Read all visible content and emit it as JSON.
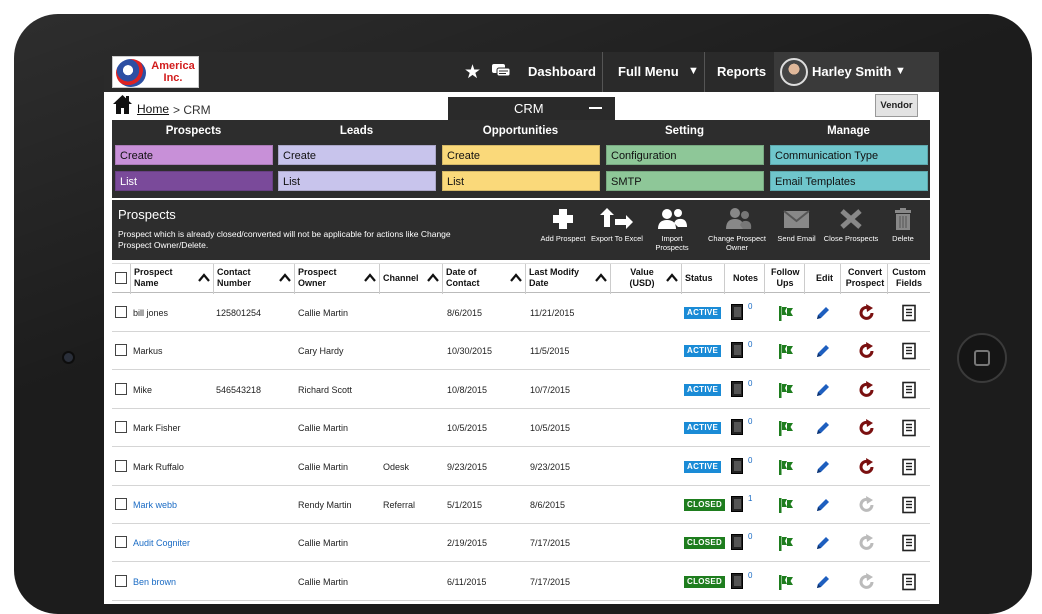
{
  "logo": {
    "text_line1": "America",
    "text_line2": "Inc."
  },
  "topnav": {
    "dashboard": "Dashboard",
    "full_menu": "Full Menu",
    "reports": "Reports",
    "user_name": "Harley Smith",
    "caret": "▼"
  },
  "breadcrumb": {
    "home": "Home",
    "current": "> CRM"
  },
  "crm_tab": "CRM",
  "vendor_button": "Vendor",
  "menu": [
    {
      "heading": "Prospects",
      "items": [
        "Create",
        "List"
      ],
      "colors": [
        "#c890d8",
        "#7a4a9a"
      ],
      "text_colors": [
        "#111111",
        "#ffffff"
      ]
    },
    {
      "heading": "Leads",
      "items": [
        "Create",
        "List"
      ],
      "colors": [
        "#c8c4ec",
        "#c8c4ec"
      ],
      "text_colors": [
        "#111111",
        "#111111"
      ]
    },
    {
      "heading": "Opportunities",
      "items": [
        "Create",
        "List"
      ],
      "colors": [
        "#fad97a",
        "#fad97a"
      ],
      "text_colors": [
        "#111111",
        "#111111"
      ]
    },
    {
      "heading": "Setting",
      "items": [
        "Configuration",
        "SMTP"
      ],
      "colors": [
        "#8ec798",
        "#8ec798"
      ],
      "text_colors": [
        "#111111",
        "#111111"
      ]
    },
    {
      "heading": "Manage",
      "items": [
        "Communication Type",
        "Email Templates"
      ],
      "colors": [
        "#6fc6cc",
        "#6fc6cc"
      ],
      "text_colors": [
        "#111111",
        "#111111"
      ]
    }
  ],
  "prospects_panel": {
    "title": "Prospects",
    "note": "Prospect which is already closed/converted will not be applicable for actions like Change Prospect Owner/Delete.",
    "actions": [
      {
        "label": "Add Prospect",
        "icon": "plus-icon"
      },
      {
        "label": "Export To Excel",
        "icon": "export-icon"
      },
      {
        "label": "Import Prospects",
        "icon": "import-users-icon"
      },
      {
        "label": "Change Prospect Owner",
        "icon": "change-owner-icon"
      },
      {
        "label": "Send Email",
        "icon": "mail-icon"
      },
      {
        "label": "Close Prospects",
        "icon": "close-x-icon"
      },
      {
        "label": "Delete",
        "icon": "trash-icon"
      }
    ]
  },
  "table": {
    "headers": {
      "name": "Prospect Name",
      "contact": "Contact Number",
      "owner": "Prospect Owner",
      "channel": "Channel",
      "date_contact": "Date of Contact",
      "last_modify": "Last Modify Date",
      "value": "Value (USD)",
      "status": "Status",
      "notes": "Notes",
      "followups": "Follow Ups",
      "edit": "Edit",
      "convert": "Convert Prospect",
      "custom": "Custom Fields"
    },
    "rows": [
      {
        "name": "bill jones",
        "contact": "125801254",
        "owner": "Callie Martin",
        "channel": "",
        "date_contact": "8/6/2015",
        "last_modify": "11/21/2015",
        "status": "ACTIVE",
        "notes": "0",
        "link": false
      },
      {
        "name": "Markus",
        "contact": "",
        "owner": "Cary Hardy",
        "channel": "",
        "date_contact": "10/30/2015",
        "last_modify": "11/5/2015",
        "status": "ACTIVE",
        "notes": "0",
        "link": false
      },
      {
        "name": "Mike",
        "contact": "546543218",
        "owner": "Richard Scott",
        "channel": "",
        "date_contact": "10/8/2015",
        "last_modify": "10/7/2015",
        "status": "ACTIVE",
        "notes": "0",
        "link": false
      },
      {
        "name": "Mark Fisher",
        "contact": "",
        "owner": "Callie Martin",
        "channel": "",
        "date_contact": "10/5/2015",
        "last_modify": "10/5/2015",
        "status": "ACTIVE",
        "notes": "0",
        "link": false
      },
      {
        "name": "Mark Ruffalo",
        "contact": "",
        "owner": "Callie Martin",
        "channel": "Odesk",
        "date_contact": "9/23/2015",
        "last_modify": "9/23/2015",
        "status": "ACTIVE",
        "notes": "0",
        "link": false
      },
      {
        "name": "Mark webb",
        "contact": "",
        "owner": "Rendy Martin",
        "channel": "Referral",
        "date_contact": "5/1/2015",
        "last_modify": "8/6/2015",
        "status": "CLOSED",
        "notes": "1",
        "link": true
      },
      {
        "name": "Audit Cogniter",
        "contact": "",
        "owner": "Callie Martin",
        "channel": "",
        "date_contact": "2/19/2015",
        "last_modify": "7/17/2015",
        "status": "CLOSED",
        "notes": "0",
        "link": true
      },
      {
        "name": "Ben brown",
        "contact": "",
        "owner": "Callie Martin",
        "channel": "",
        "date_contact": "6/11/2015",
        "last_modify": "7/17/2015",
        "status": "CLOSED",
        "notes": "0",
        "link": true
      }
    ]
  }
}
